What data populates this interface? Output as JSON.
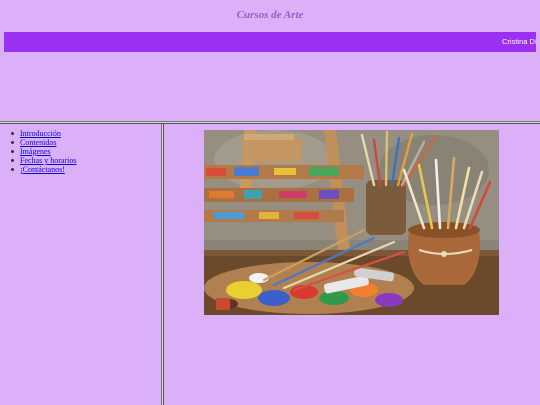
{
  "header": {
    "title": "Cursos de Arte",
    "marquee_text": "Cristina Día"
  },
  "nav": {
    "items": [
      {
        "label": "Introducción"
      },
      {
        "label": "Contenidos"
      },
      {
        "label": "Imágenes"
      },
      {
        "label": "Fechas y horarios"
      },
      {
        "label": "¡Contáctanos!"
      }
    ]
  },
  "content": {
    "image": "art-supplies-photo"
  },
  "colors": {
    "background": "#dcb0f8",
    "marquee_bar": "#9b30f2",
    "title": "#9b59d0",
    "link": "#0a0ad0"
  }
}
